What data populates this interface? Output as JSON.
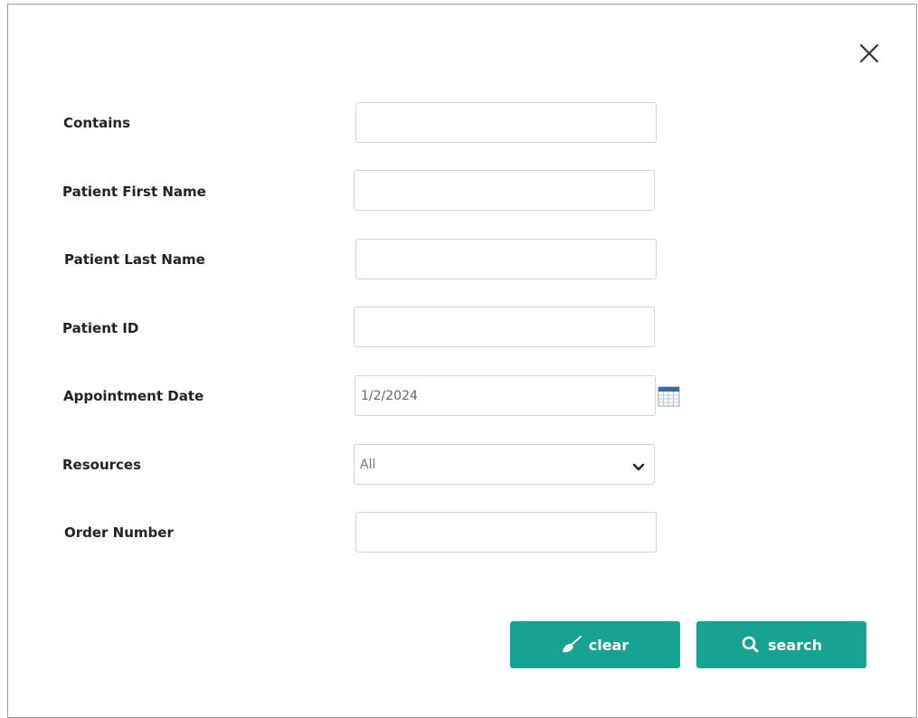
{
  "form": {
    "fields": [
      {
        "label": "Contains",
        "value": ""
      },
      {
        "label": "Patient First Name",
        "value": ""
      },
      {
        "label": "Patient Last Name",
        "value": ""
      },
      {
        "label": "Patient ID",
        "value": ""
      },
      {
        "label": "Appointment Date",
        "value": "1/2/2024"
      },
      {
        "label": "Resources",
        "selected": "All"
      },
      {
        "label": "Order Number",
        "value": ""
      }
    ]
  },
  "buttons": {
    "clear_label": "clear",
    "search_label": "search"
  },
  "icons": {
    "close": "close-icon",
    "calendar": "calendar-icon",
    "clear": "broom-icon",
    "search": "magnifier-icon",
    "dropdown": "chevron-down-icon"
  },
  "colors": {
    "accent": "#17a291",
    "border": "#d4d4d4"
  }
}
